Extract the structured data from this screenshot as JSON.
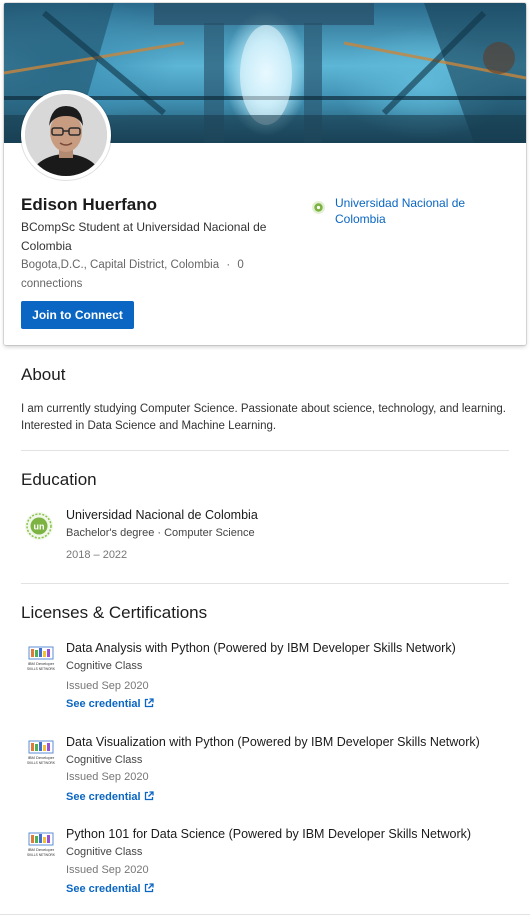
{
  "profile": {
    "name": "Edison Huerfano",
    "headline": "BCompSc Student at Universidad Nacional de Colombia",
    "location": "Bogota,D.C., Capital District, Colombia",
    "separator": "·",
    "connections": "0 connections",
    "join_button": "Join to Connect",
    "education_link": "Universidad Nacional de Colombia"
  },
  "about": {
    "heading": "About",
    "text": "I am currently studying Computer Science. Passionate about science, technology, and learning. Interested in Data Science and Machine Learning."
  },
  "education": {
    "heading": "Education",
    "items": [
      {
        "school": "Universidad Nacional de Colombia",
        "degree": "Bachelor's degree · Computer Science",
        "dates": "2018 – 2022",
        "logo_text": "un"
      }
    ]
  },
  "certifications": {
    "heading": "Licenses & Certifications",
    "items": [
      {
        "title": "Data Analysis with Python (Powered by IBM Developer Skills Network)",
        "issuer": "Cognitive Class",
        "issued": "Issued Sep 2020",
        "link": "See credential",
        "logo_line1": "IBM Developer",
        "logo_line2": "SKILLS NETWORK"
      },
      {
        "title": "Data Visualization with Python (Powered by IBM Developer Skills Network)",
        "issuer": "Cognitive Class",
        "issued": "Issued Sep 2020",
        "link": "See credential",
        "logo_line1": "IBM Developer",
        "logo_line2": "SKILLS NETWORK"
      },
      {
        "title": "Python 101 for Data Science (Powered by IBM Developer Skills Network)",
        "issuer": "Cognitive Class",
        "issued": "Issued Sep 2020",
        "link": "See credential",
        "logo_line1": "IBM Developer",
        "logo_line2": "SKILLS NETWORK"
      }
    ]
  },
  "colors": {
    "link_blue": "#0a66c2",
    "uni_green": "#7cb342"
  }
}
